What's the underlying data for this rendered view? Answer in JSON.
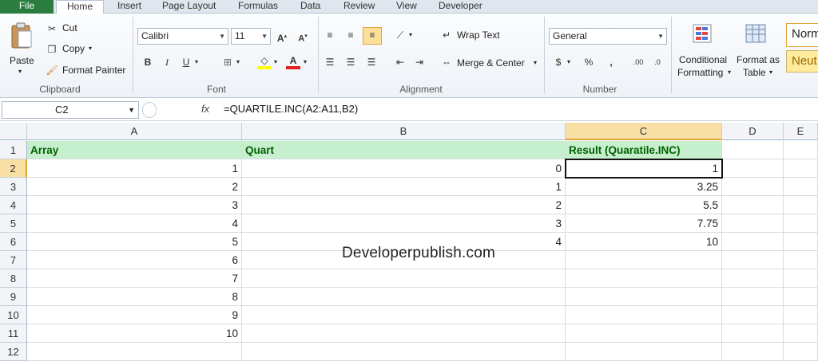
{
  "tabs": [
    "File",
    "Home",
    "Insert",
    "Page Layout",
    "Formulas",
    "Data",
    "Review",
    "View",
    "Developer"
  ],
  "clipboard": {
    "paste": "Paste",
    "cut": "Cut",
    "copy": "Copy",
    "format_painter": "Format Painter",
    "label": "Clipboard"
  },
  "font": {
    "name": "Calibri",
    "size": "11",
    "label": "Font"
  },
  "alignment": {
    "wrap_text": "Wrap Text",
    "merge_center": "Merge & Center",
    "label": "Alignment"
  },
  "number": {
    "format": "General",
    "label": "Number"
  },
  "styles": {
    "conditional": "Conditional",
    "formatting": "Formatting",
    "format_as": "Format as",
    "table": "Table",
    "normal": "Norm",
    "neutral": "Neut"
  },
  "formula_bar": {
    "name_box": "C2",
    "fx": "fx",
    "formula": "=QUARTILE.INC(A2:A11,B2)"
  },
  "columns": [
    "A",
    "B",
    "C",
    "D",
    "E"
  ],
  "rows": [
    "1",
    "2",
    "3",
    "4",
    "5",
    "6",
    "7",
    "8",
    "9",
    "10",
    "11",
    "12"
  ],
  "headers": {
    "a": "Array",
    "b": "Quart",
    "c": "Result (Quaratile.INC)"
  },
  "col_a": [
    "1",
    "2",
    "3",
    "4",
    "5",
    "6",
    "7",
    "8",
    "9",
    "10"
  ],
  "col_b": [
    "0",
    "1",
    "2",
    "3",
    "4"
  ],
  "col_c": [
    "1",
    "3.25",
    "5.5",
    "7.75",
    "10"
  ],
  "watermark": "Developerpublish.com"
}
